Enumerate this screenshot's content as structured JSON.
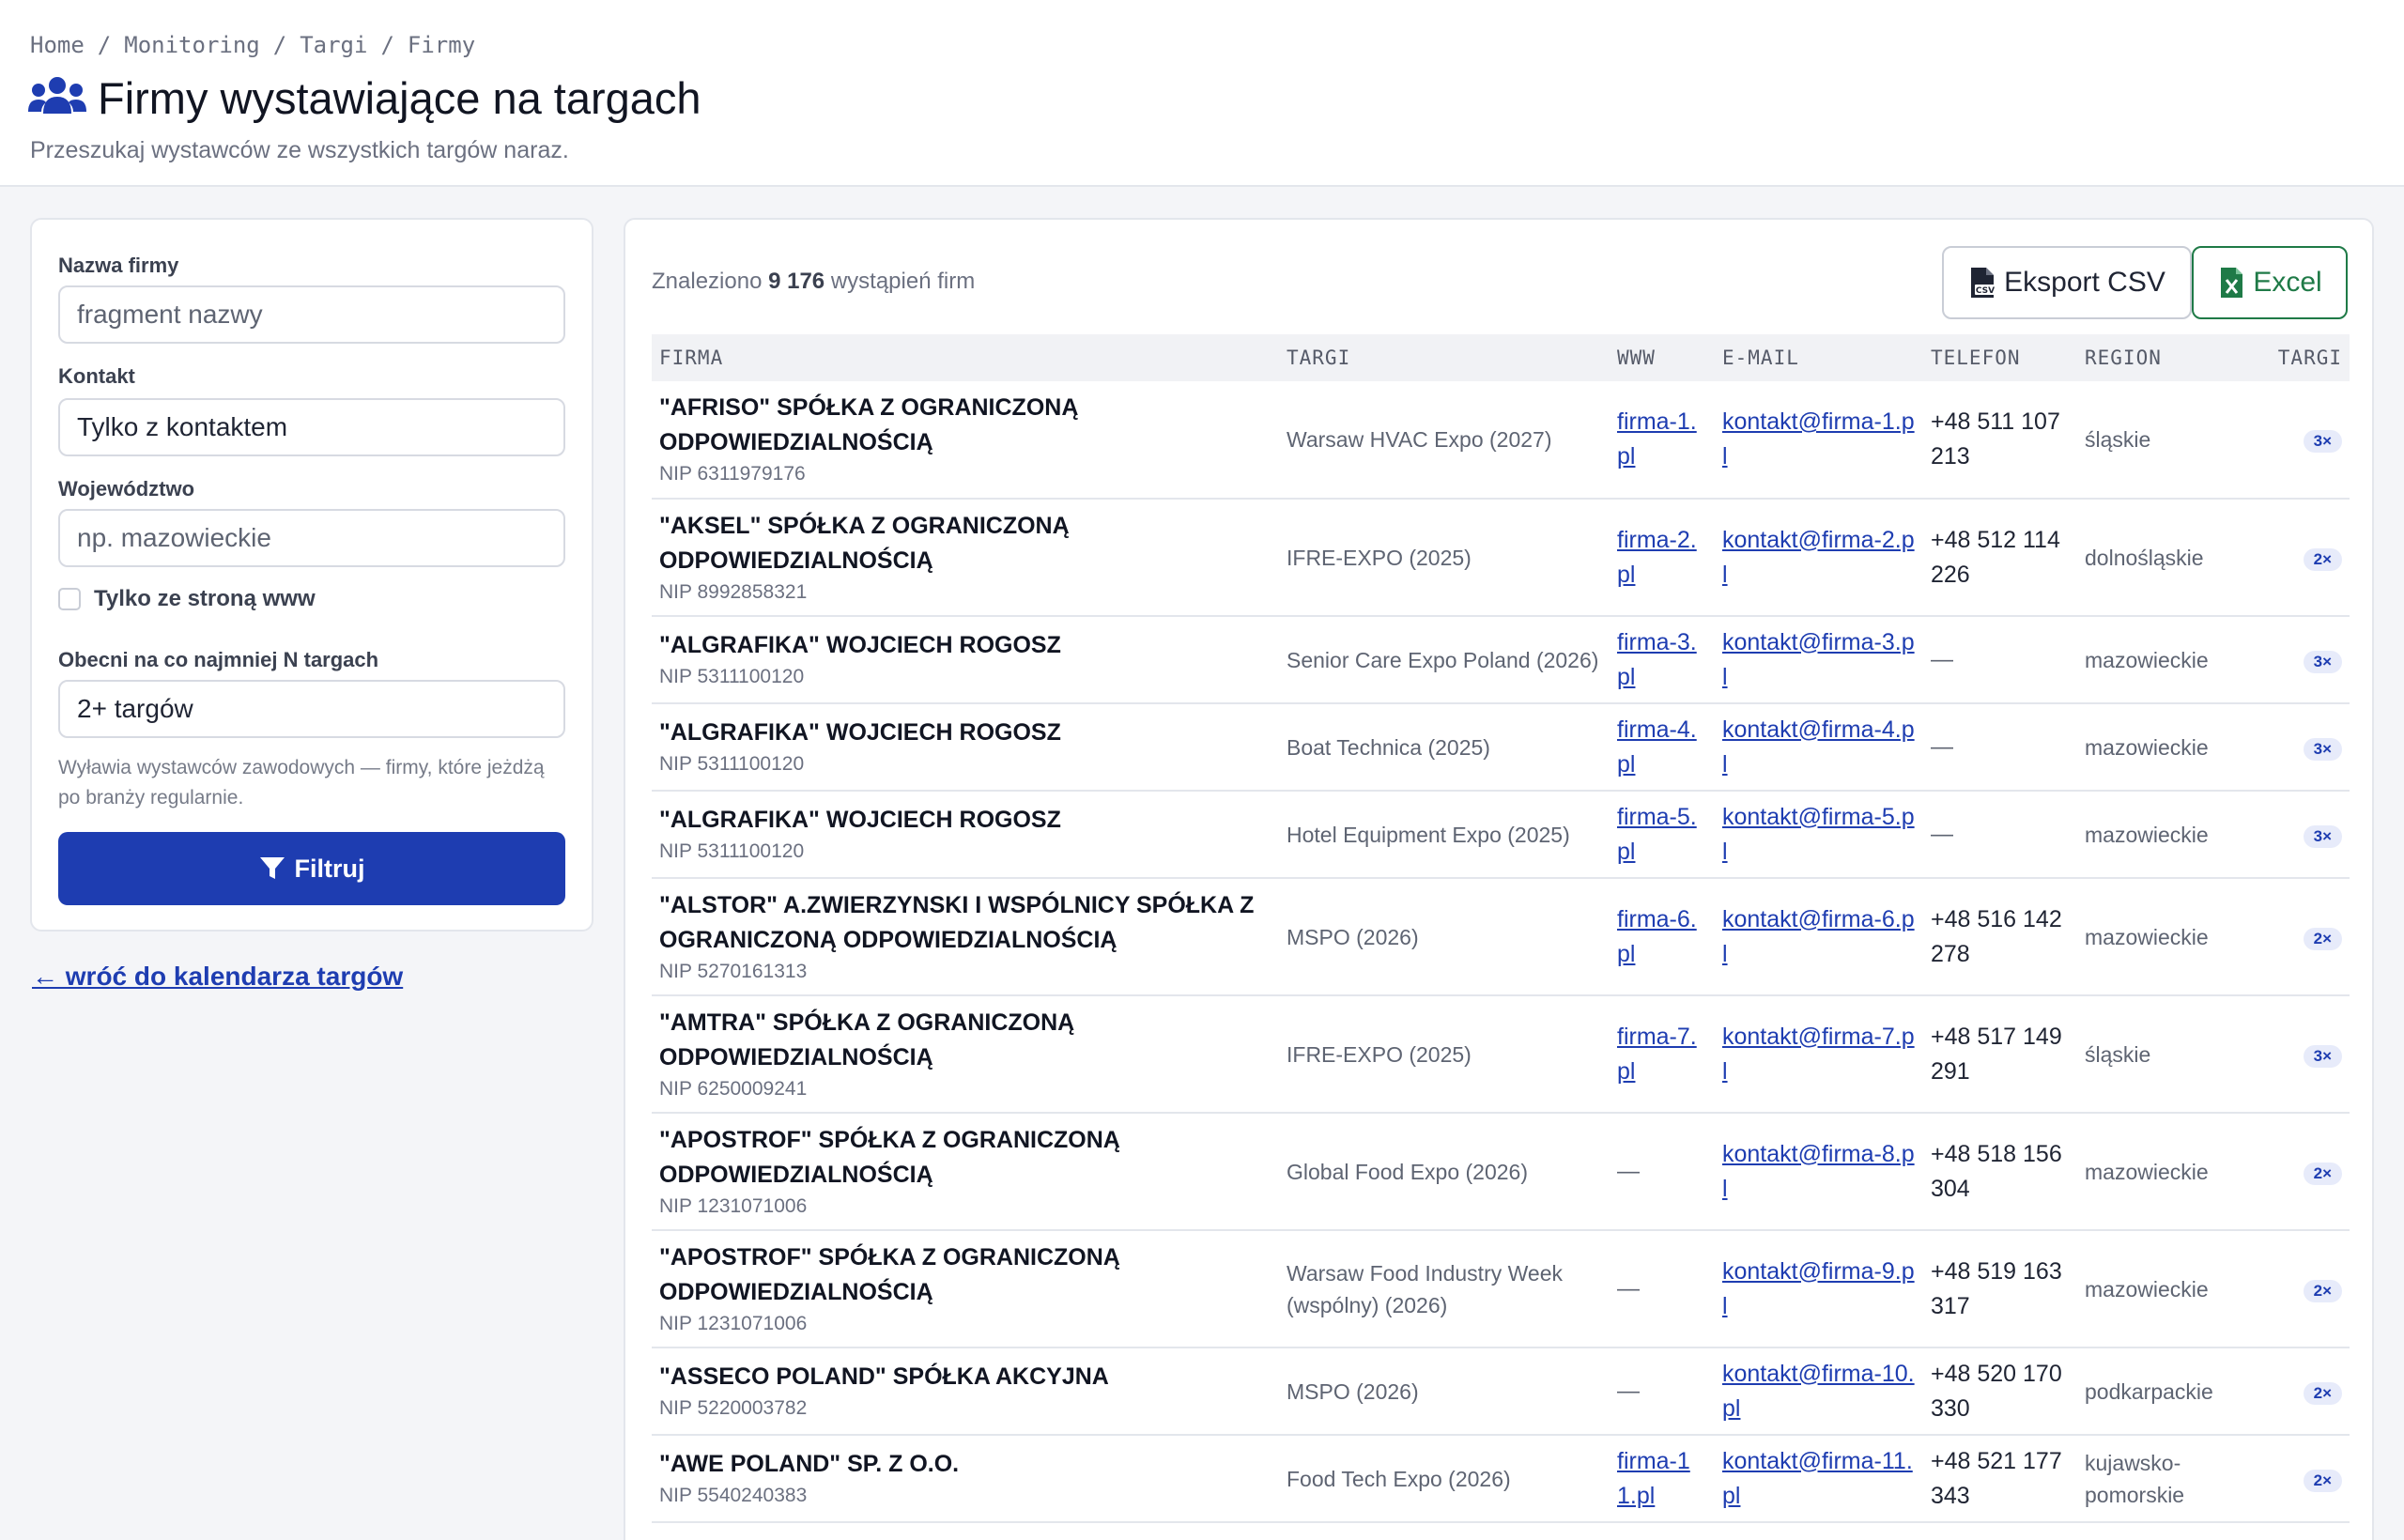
{
  "breadcrumb": [
    "Home",
    "Monitoring",
    "Targi",
    "Firmy"
  ],
  "page": {
    "title": "Firmy wystawiające na targach",
    "subtitle": "Przeszukaj wystawców ze wszystkich targów naraz."
  },
  "filters": {
    "name_label": "Nazwa firmy",
    "name_placeholder": "fragment nazwy",
    "contact_label": "Kontakt",
    "contact_value": "Tylko z kontaktem",
    "region_label": "Województwo",
    "region_placeholder": "np. mazowieckie",
    "www_only_label": "Tylko ze stroną www",
    "min_fairs_label": "Obecni na co najmniej N targach",
    "min_fairs_value": "2+ targów",
    "hint": "Wyławia wystawców zawodowych — firmy, które jeżdżą po branży regularnie.",
    "submit_label": "Filtruj"
  },
  "back_link": "← wróć do kalendarza targów",
  "results": {
    "count_prefix": "Znaleziono",
    "count": "9 176",
    "count_suffix": "wystąpień firm",
    "csv_label": "Eksport CSV",
    "excel_label": "Excel",
    "columns": [
      "FIRMA",
      "TARGI",
      "WWW",
      "E-MAIL",
      "TELEFON",
      "REGION",
      "TARGI"
    ],
    "rows": [
      {
        "name": "\"AFRISO\" SPÓŁKA Z OGRANICZONĄ ODPOWIEDZIALNOŚCIĄ",
        "nip": "NIP 6311979176",
        "fair": "Warsaw HVAC Expo (2027)",
        "www": "firma-1.pl",
        "email": "kontakt@firma-1.pl",
        "phone": "+48 511 107 213",
        "region": "śląskie",
        "count": "3×"
      },
      {
        "name": "\"AKSEL\" SPÓŁKA Z OGRANICZONĄ ODPOWIEDZIALNOŚCIĄ",
        "nip": "NIP 8992858321",
        "fair": "IFRE-EXPO (2025)",
        "www": "firma-2.pl",
        "email": "kontakt@firma-2.pl",
        "phone": "+48 512 114 226",
        "region": "dolnośląskie",
        "count": "2×"
      },
      {
        "name": "\"ALGRAFIKA\" WOJCIECH ROGOSZ",
        "nip": "NIP 5311100120",
        "fair": "Senior Care Expo Poland (2026)",
        "www": "firma-3.pl",
        "email": "kontakt@firma-3.pl",
        "phone": "—",
        "region": "mazowieckie",
        "count": "3×"
      },
      {
        "name": "\"ALGRAFIKA\" WOJCIECH ROGOSZ",
        "nip": "NIP 5311100120",
        "fair": "Boat Technica (2025)",
        "www": "firma-4.pl",
        "email": "kontakt@firma-4.pl",
        "phone": "—",
        "region": "mazowieckie",
        "count": "3×"
      },
      {
        "name": "\"ALGRAFIKA\" WOJCIECH ROGOSZ",
        "nip": "NIP 5311100120",
        "fair": "Hotel Equipment Expo (2025)",
        "www": "firma-5.pl",
        "email": "kontakt@firma-5.pl",
        "phone": "—",
        "region": "mazowieckie",
        "count": "3×"
      },
      {
        "name": "\"ALSTOR\" A.ZWIERZYNSKI I WSPÓLNICY SPÓŁKA Z OGRANICZONĄ ODPOWIEDZIALNOŚCIĄ",
        "nip": "NIP 5270161313",
        "fair": "MSPO (2026)",
        "www": "firma-6.pl",
        "email": "kontakt@firma-6.pl",
        "phone": "+48 516 142 278",
        "region": "mazowieckie",
        "count": "2×"
      },
      {
        "name": "\"AMTRA\" SPÓŁKA Z OGRANICZONĄ ODPOWIEDZIALNOŚCIĄ",
        "nip": "NIP 6250009241",
        "fair": "IFRE-EXPO (2025)",
        "www": "firma-7.pl",
        "email": "kontakt@firma-7.pl",
        "phone": "+48 517 149 291",
        "region": "śląskie",
        "count": "3×"
      },
      {
        "name": "\"APOSTROF\" SPÓŁKA Z OGRANICZONĄ ODPOWIEDZIALNOŚCIĄ",
        "nip": "NIP 1231071006",
        "fair": "Global Food Expo (2026)",
        "www": "—",
        "email": "kontakt@firma-8.pl",
        "phone": "+48 518 156 304",
        "region": "mazowieckie",
        "count": "2×"
      },
      {
        "name": "\"APOSTROF\" SPÓŁKA Z OGRANICZONĄ ODPOWIEDZIALNOŚCIĄ",
        "nip": "NIP 1231071006",
        "fair": "Warsaw Food Industry Week (wspólny) (2026)",
        "www": "—",
        "email": "kontakt@firma-9.pl",
        "phone": "+48 519 163 317",
        "region": "mazowieckie",
        "count": "2×"
      },
      {
        "name": "\"ASSECO POLAND\" SPÓŁKA AKCYJNA",
        "nip": "NIP 5220003782",
        "fair": "MSPO (2026)",
        "www": "—",
        "email": "kontakt@firma-10.pl",
        "phone": "+48 520 170 330",
        "region": "podkarpackie",
        "count": "2×"
      },
      {
        "name": "\"AWE POLAND\" SP. Z O.O.",
        "nip": "NIP 5540240383",
        "fair": "Food Tech Expo (2026)",
        "www": "firma-11.pl",
        "email": "kontakt@firma-11.pl",
        "phone": "+48 521 177 343",
        "region": "kujawsko-pomorskie",
        "count": "2×"
      }
    ]
  }
}
